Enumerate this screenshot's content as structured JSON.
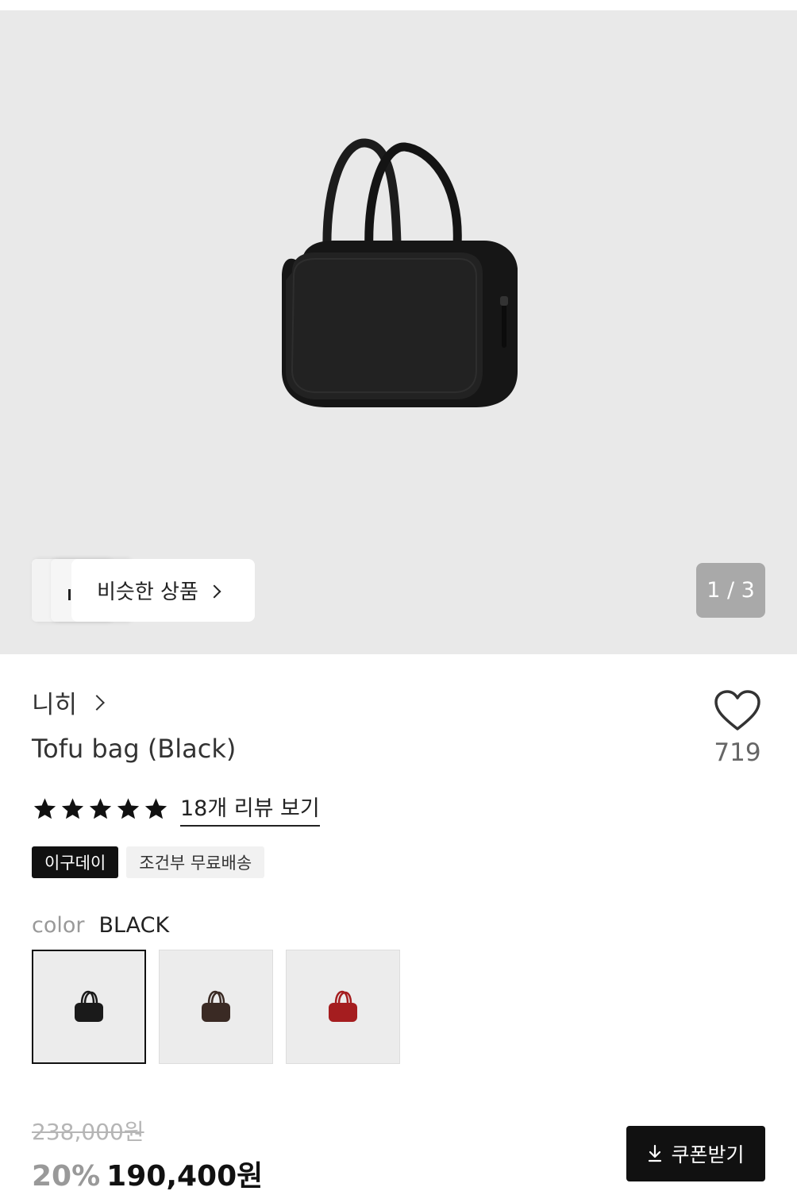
{
  "gallery": {
    "counter": "1 / 3",
    "similar_label": "비슷한 상품"
  },
  "product": {
    "brand": "니히",
    "title": "Tofu bag (Black)",
    "likes": "719",
    "rating_stars": 5,
    "review_link": "18개 리뷰 보기",
    "tags": [
      "이구데이",
      "조건부 무료배송"
    ],
    "color_label": "color",
    "color_value": "BLACK",
    "swatches": [
      {
        "color": "#1a1a1a",
        "selected": true
      },
      {
        "color": "#3a2a24",
        "selected": false
      },
      {
        "color": "#a51d1f",
        "selected": false
      }
    ]
  },
  "pricing": {
    "original_price": "238,000원",
    "discount": "20%",
    "sale_price": "190,400원",
    "coupon_button": "쿠폰받기"
  },
  "colors": {
    "bag_main": "#1c1c1c",
    "hero_bg": "#e9e9e9",
    "counter_bg": "#a9a9a9"
  }
}
